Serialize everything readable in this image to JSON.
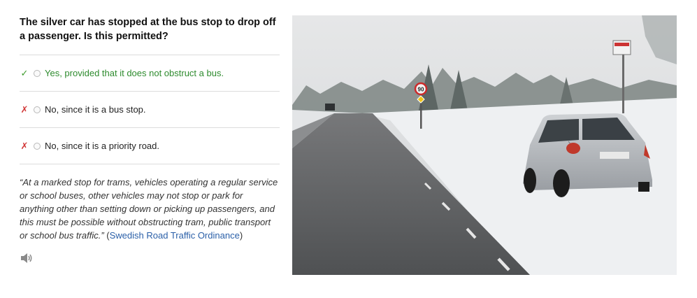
{
  "question": "The silver car has stopped at the bus stop to drop off a passenger. Is this permitted?",
  "answers": [
    {
      "mark": "✓",
      "status": "correct",
      "label": "Yes, provided that it does not obstruct a bus."
    },
    {
      "mark": "✗",
      "status": "incorrect",
      "label": "No, since it is a bus stop."
    },
    {
      "mark": "✗",
      "status": "incorrect",
      "label": "No, since it is a priority road."
    }
  ],
  "explanation": {
    "quote": "“At a marked stop for trams, vehicles operating a regular service or school buses, other vehicles may not stop or park for anything other than setting down or picking up passengers, and this must be possible without obstructing tram, public transport or school bus traffic.”",
    "source_open": " (",
    "source_link": "Swedish Road Traffic Ordinance",
    "source_close": ")"
  },
  "audio_icon": "speaker-icon",
  "photo": {
    "speed_sign": "90"
  },
  "colors": {
    "correct": "#3c9a2b",
    "incorrect": "#d23a3a",
    "link": "#2a5fa8"
  }
}
